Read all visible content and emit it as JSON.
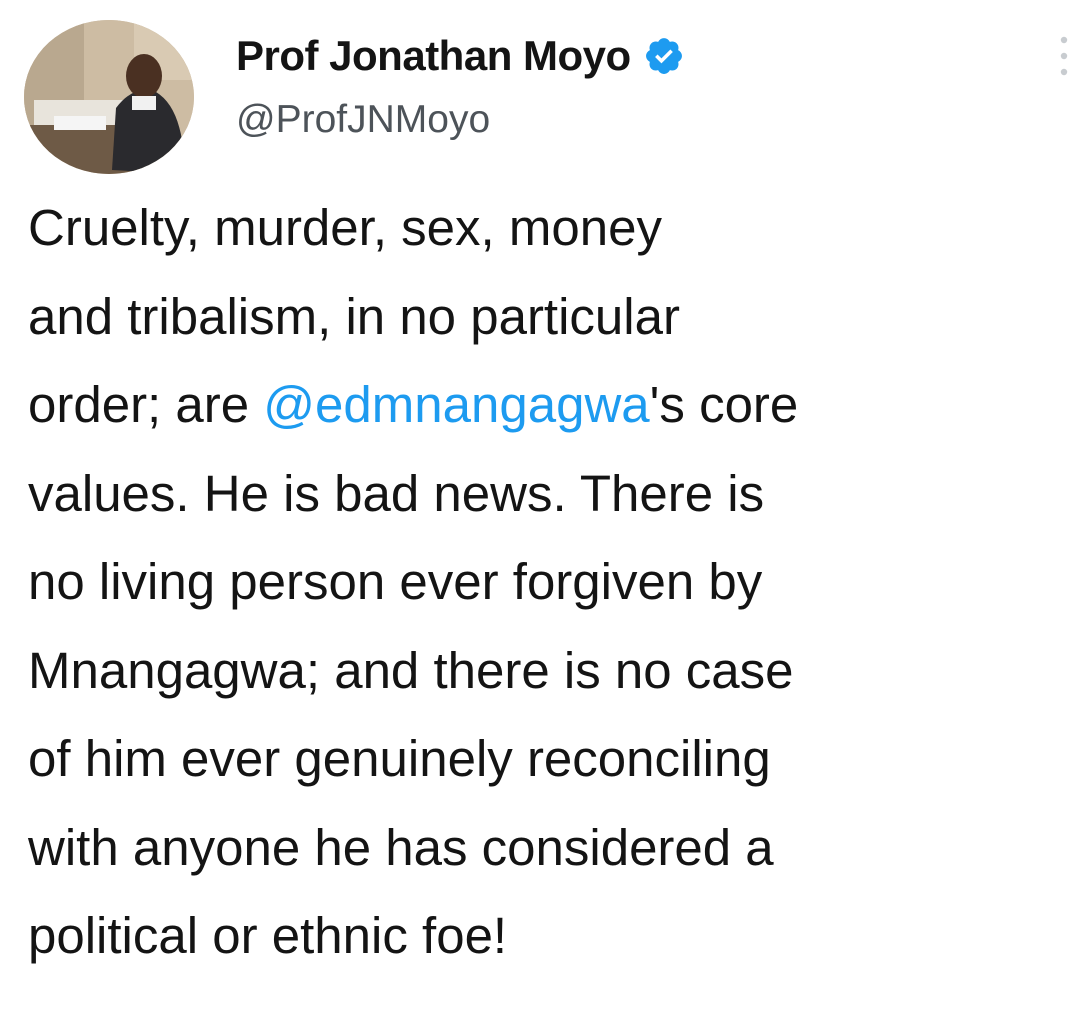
{
  "tweet": {
    "author": {
      "display_name": "Prof Jonathan Moyo",
      "handle": "@ProfJNMoyo",
      "verified": true,
      "avatar_icon": "profile-photo"
    },
    "menu_icon": "more-vertical-icon",
    "text_lines": [
      {
        "before": "Cruelty, murder, sex, money"
      },
      {
        "before": "and tribalism, in no particular"
      },
      {
        "before": "order; are ",
        "mention": "@edmnangagwa",
        "after": "'s core"
      },
      {
        "before": "values. He is bad news. There is"
      },
      {
        "before": "no living person ever forgiven by"
      },
      {
        "before": "Mnangagwa; and there is no case"
      },
      {
        "before": "of him ever genuinely reconciling"
      },
      {
        "before": "with anyone he has considered a"
      },
      {
        "before": "political or ethnic foe!"
      }
    ]
  },
  "colors": {
    "text": "#141414",
    "secondary_text": "#4d5359",
    "mention": "#1d9bf0",
    "verified_badge": "#1d9bf0",
    "background": "#ffffff"
  }
}
